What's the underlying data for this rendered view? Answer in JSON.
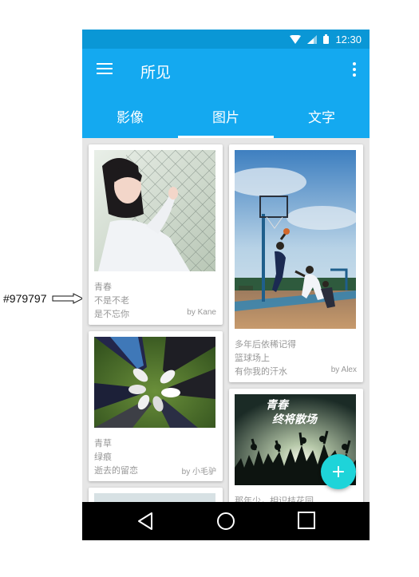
{
  "annotation": {
    "label": "#979797"
  },
  "status_bar": {
    "time": "12:30",
    "icons": [
      "wifi-icon",
      "signal-icon",
      "battery-icon"
    ]
  },
  "app_bar": {
    "title": "所见",
    "menu_icon": "menu-icon",
    "more_icon": "more-vert-icon"
  },
  "tabs": [
    {
      "label": "影像",
      "active": false
    },
    {
      "label": "图片",
      "active": true
    },
    {
      "label": "文字",
      "active": false
    }
  ],
  "cards": [
    {
      "lines": [
        "青春",
        "不是不老",
        "是不忘你"
      ],
      "author": "by Kane"
    },
    {
      "lines": [
        "多年后依稀记得",
        "篮球场上",
        "有你我的汗水"
      ],
      "author": "by Alex"
    },
    {
      "lines": [
        "青草",
        "绿痕",
        "逝去的留恋"
      ],
      "author": "by 小毛驴"
    },
    {
      "lines": [
        "那年少，相识桔花园"
      ],
      "photo_text": [
        "青春",
        "终将散场"
      ]
    }
  ],
  "fab": {
    "label": "+"
  },
  "nav_bar": [
    "back-icon",
    "home-icon",
    "recents-icon"
  ],
  "colors": {
    "status_bar": "#0a97d6",
    "app_bar": "#14a9f0",
    "fab": "#1ed4d9",
    "card_text": "#979797"
  }
}
